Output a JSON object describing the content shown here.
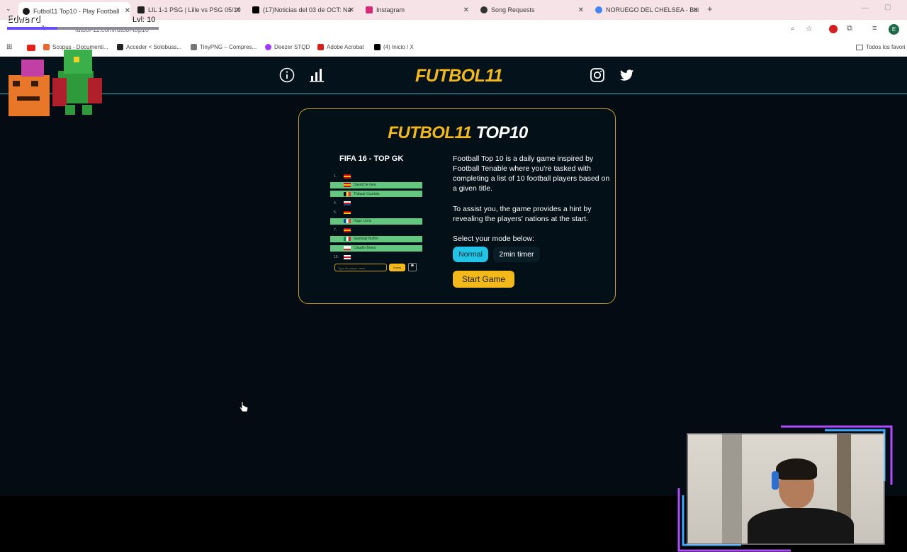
{
  "browser": {
    "tabs": [
      {
        "title": "Futbol11 Top10 - Play Football",
        "active": true,
        "color": "#1a1a1a"
      },
      {
        "title": "LIL 1-1 PSG | Lille vs PSG 05/10",
        "active": false,
        "color": "#222"
      },
      {
        "title": "(17)Noticias del 03 de OCT: Ná",
        "active": false,
        "color": "#000"
      },
      {
        "title": "Instagram",
        "active": false,
        "color": "#d62976"
      },
      {
        "title": "Song Requests",
        "active": false,
        "color": "#333"
      },
      {
        "title": "NORUEGO DEL CHELSEA - Busc",
        "active": false,
        "color": "#4285f4"
      }
    ],
    "url": "futbol-11.com/futbol-top10",
    "bookmarks": [
      {
        "label": "Scopus - Documenti...",
        "color": "#e8692e"
      },
      {
        "label": "Acceder < Solobuss...",
        "color": "#222"
      },
      {
        "label": "TinyPNG – Compres...",
        "color": "#777"
      },
      {
        "label": "Deezer STQD",
        "color": "#a238ff"
      },
      {
        "label": "Adobe Acrobat",
        "color": "#d4221b"
      },
      {
        "label": "(4) Inicio / X",
        "color": "#000"
      }
    ],
    "all_bookmarks_label": "Todos los favori",
    "profile_initial": "E"
  },
  "site": {
    "logo_text": "FUTBOL11",
    "header_icons": [
      "info-icon",
      "stats-icon",
      "instagram-icon",
      "twitter-icon"
    ],
    "accent": "#f3b81a",
    "card": {
      "title_yellow": "FUTBOL11",
      "title_white": "TOP10",
      "preview": {
        "title": "FIFA 16 - TOP GK",
        "rows": [
          {
            "num": "1.",
            "name": "",
            "filled": false,
            "flag": "spain"
          },
          {
            "num": "2.",
            "name": "David De Gea",
            "filled": true,
            "flag": "spain"
          },
          {
            "num": "3.",
            "name": "Thibaut Courtois",
            "filled": true,
            "flag": "belgium"
          },
          {
            "num": "4.",
            "name": "",
            "filled": false,
            "flag": "czech"
          },
          {
            "num": "5.",
            "name": "",
            "filled": false,
            "flag": "germany"
          },
          {
            "num": "6.",
            "name": "Hugo Lloris",
            "filled": true,
            "flag": "france"
          },
          {
            "num": "7.",
            "name": "",
            "filled": false,
            "flag": "spain"
          },
          {
            "num": "8.",
            "name": "Gianluigi Buffon",
            "filled": true,
            "flag": "italy"
          },
          {
            "num": "9.",
            "name": "Claudio Bravo",
            "filled": true,
            "flag": "chile"
          },
          {
            "num": "10.",
            "name": "",
            "filled": false,
            "flag": "england"
          }
        ],
        "input_placeholder": "Type the player name",
        "guess_label": "Guess"
      },
      "description_1": "Football Top 10 is a daily game inspired by Football Tenable where you're tasked with completing a list of 10 football players based on a given title.",
      "description_2": "To assist you, the game provides a hint by revealing the players' nations at the start.",
      "mode_label": "Select your mode below:",
      "modes": [
        {
          "label": "Normal",
          "selected": true
        },
        {
          "label": "2min timer",
          "selected": false
        }
      ],
      "start_label": "Start Game"
    }
  },
  "overlay": {
    "streamer_name": "Edward",
    "level": "Lvl: 10",
    "xp_fraction": 0.33
  }
}
